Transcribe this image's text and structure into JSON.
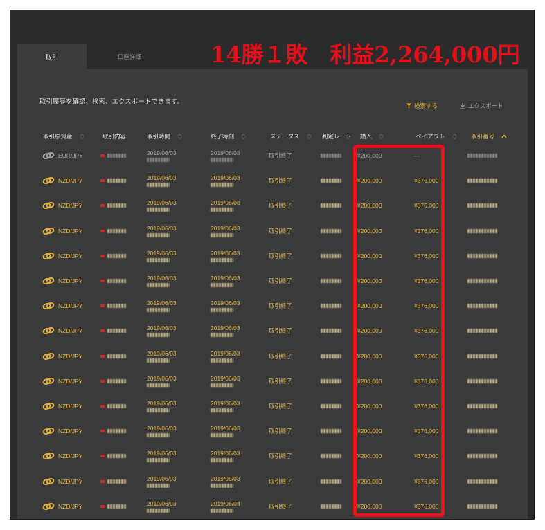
{
  "overlay_caption": "14勝１敗　利益2,264,000円",
  "tabs": [
    {
      "label": "取引",
      "active": true
    },
    {
      "label": "口座詳細",
      "active": false
    }
  ],
  "description": "取引履歴を確認、検索、エクスポートできます。",
  "actions": {
    "search_label": "検索する",
    "search_icon": "filter-icon",
    "export_label": "エクスポート",
    "export_icon": "download-icon"
  },
  "table": {
    "asset_icon": "currency-pair-icon",
    "headers": [
      {
        "label": "取引原資産",
        "sort_icon": "sort-icon",
        "active": false
      },
      {
        "label": "取引内容",
        "sort_icon": null,
        "active": false
      },
      {
        "label": "取引時間",
        "sort_icon": "sort-icon",
        "active": false
      },
      {
        "label": "終了時刻",
        "sort_icon": "sort-icon",
        "active": false
      },
      {
        "label": "ステータス",
        "sort_icon": "sort-icon",
        "active": false
      },
      {
        "label": "判定レート",
        "sort_icon": null,
        "active": false
      },
      {
        "label": "購入",
        "sort_icon": "sort-icon",
        "active": false
      },
      {
        "label": "ペイアウト",
        "sort_icon": "sort-icon",
        "active": false
      },
      {
        "label": "取引番号",
        "sort_icon": "sort-asc-icon",
        "active": true
      }
    ],
    "rows": [
      {
        "asset": "EUR/JPY",
        "start_date": "2019/06/03",
        "end_date": "2019/06/03",
        "status": "取引終了",
        "purchase": "¥200,000",
        "payout": "—",
        "highlight": false
      },
      {
        "asset": "NZD/JPY",
        "start_date": "2019/06/03",
        "end_date": "2019/06/03",
        "status": "取引終了",
        "purchase": "¥200,000",
        "payout": "¥376,000",
        "highlight": true
      },
      {
        "asset": "NZD/JPY",
        "start_date": "2019/06/03",
        "end_date": "2019/06/03",
        "status": "取引終了",
        "purchase": "¥200,000",
        "payout": "¥376,000",
        "highlight": true
      },
      {
        "asset": "NZD/JPY",
        "start_date": "2019/06/03",
        "end_date": "2019/06/03",
        "status": "取引終了",
        "purchase": "¥200,000",
        "payout": "¥376,000",
        "highlight": true
      },
      {
        "asset": "NZD/JPY",
        "start_date": "2019/06/03",
        "end_date": "2019/06/03",
        "status": "取引終了",
        "purchase": "¥200,000",
        "payout": "¥376,000",
        "highlight": true
      },
      {
        "asset": "NZD/JPY",
        "start_date": "2019/06/03",
        "end_date": "2019/06/03",
        "status": "取引終了",
        "purchase": "¥200,000",
        "payout": "¥376,000",
        "highlight": true
      },
      {
        "asset": "NZD/JPY",
        "start_date": "2019/06/03",
        "end_date": "2019/06/03",
        "status": "取引終了",
        "purchase": "¥200,000",
        "payout": "¥376,000",
        "highlight": true
      },
      {
        "asset": "NZD/JPY",
        "start_date": "2019/06/03",
        "end_date": "2019/06/03",
        "status": "取引終了",
        "purchase": "¥200,000",
        "payout": "¥376,000",
        "highlight": true
      },
      {
        "asset": "NZD/JPY",
        "start_date": "2019/06/03",
        "end_date": "2019/06/03",
        "status": "取引終了",
        "purchase": "¥200,000",
        "payout": "¥376,000",
        "highlight": true
      },
      {
        "asset": "NZD/JPY",
        "start_date": "2019/06/03",
        "end_date": "2019/06/03",
        "status": "取引終了",
        "purchase": "¥200,000",
        "payout": "¥376,000",
        "highlight": true
      },
      {
        "asset": "NZD/JPY",
        "start_date": "2019/06/03",
        "end_date": "2019/06/03",
        "status": "取引終了",
        "purchase": "¥200,000",
        "payout": "¥376,000",
        "highlight": true
      },
      {
        "asset": "NZD/JPY",
        "start_date": "2019/06/03",
        "end_date": "2019/06/03",
        "status": "取引終了",
        "purchase": "¥200,000",
        "payout": "¥376,000",
        "highlight": true
      },
      {
        "asset": "NZD/JPY",
        "start_date": "2019/06/03",
        "end_date": "2019/06/03",
        "status": "取引終了",
        "purchase": "¥200,000",
        "payout": "¥376,000",
        "highlight": true
      },
      {
        "asset": "NZD/JPY",
        "start_date": "2019/06/03",
        "end_date": "2019/06/03",
        "status": "取引終了",
        "purchase": "¥200,000",
        "payout": "¥376,000",
        "highlight": true
      },
      {
        "asset": "NZD/JPY",
        "start_date": "2019/06/03",
        "end_date": "2019/06/03",
        "status": "取引終了",
        "purchase": "¥200,000",
        "payout": "¥376,000",
        "highlight": true
      }
    ]
  },
  "colors": {
    "accent": "#e6b33a",
    "muted": "#a3a3a3",
    "header_text": "#dcdcdc",
    "caption_red": "#e3101b",
    "box_red": "#e8121c",
    "panel": "#3a3a3a",
    "frame": "#2b2b2b",
    "blur_accent": "#cbbd93",
    "blur_muted": "#8f8f8f",
    "mark": "#c62a1f"
  }
}
